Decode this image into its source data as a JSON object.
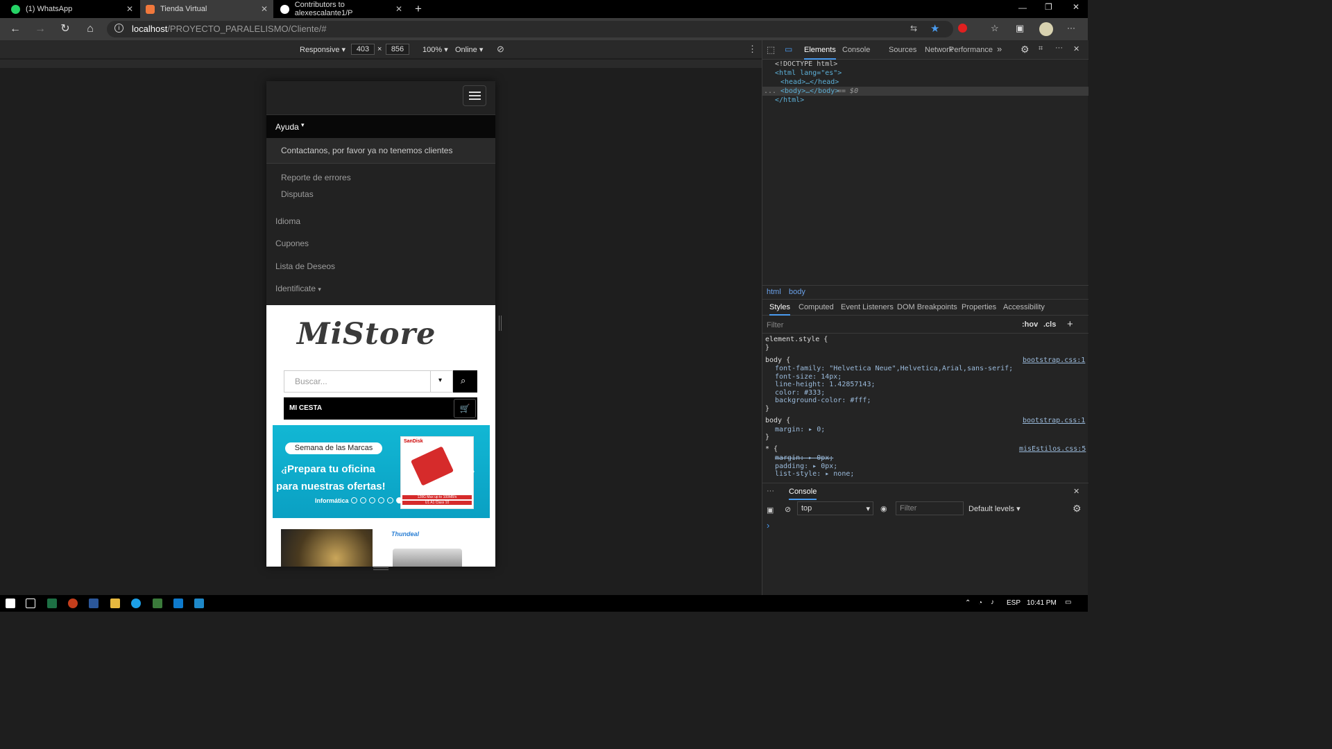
{
  "browser": {
    "tabs": [
      {
        "label": "(1) WhatsApp",
        "icon": "whatsapp-icon"
      },
      {
        "label": "Tienda Virtual",
        "icon": "xampp-icon"
      },
      {
        "label": "Contributors to alexescalante1/P",
        "icon": "github-icon"
      }
    ],
    "new_tab": "+",
    "url_host": "localhost",
    "url_path": "/PROYECTO_PARALELISMO/Cliente/#",
    "info": "i"
  },
  "device": {
    "mode": "Responsive",
    "width": "403",
    "height": "856",
    "times": "×",
    "zoom": "100%",
    "network": "Online"
  },
  "page": {
    "menu": {
      "ayuda": "Ayuda",
      "contact": "Contactanos, por favor ya no tenemos clientes",
      "reporte": "Reporte de errores",
      "disputas": "Disputas",
      "idioma": "Idioma",
      "cupones": "Cupones",
      "deseos": "Lista de Deseos",
      "identificate": "Identificate"
    },
    "logo": "MiStore",
    "search_placeholder": "Buscar...",
    "cesta": "MI CESTA",
    "banner": {
      "pill": "Semana de las Marcas",
      "line1": "¡Prepara tu oficina",
      "line2": "para nuestras ofertas!",
      "category": "Informática",
      "brand": "SanDisk",
      "spec1": "128G Max up to 100MB/s",
      "spec2": "U1 A1 Class 10",
      "original": "SanDisk Original",
      "slides": 6,
      "active_slide": 6
    },
    "thumb2_brand": "Thundeal"
  },
  "devtools": {
    "tabs": [
      "Elements",
      "Console",
      "Sources",
      "Network",
      "Performance"
    ],
    "active_tab": "Elements",
    "more": "»",
    "tree": {
      "l1": "<!DOCTYPE html>",
      "l2": "<html lang=\"es\">",
      "l3": "<head>…</head>",
      "l4": "<body>…</body>",
      "l4b": "== $0",
      "l5": "</html>",
      "dots": "..."
    },
    "crumbs": [
      "html",
      "body"
    ],
    "style_tabs": [
      "Styles",
      "Computed",
      "Event Listeners",
      "DOM Breakpoints",
      "Properties",
      "Accessibility"
    ],
    "filter": "Filter",
    "hov": ":hov",
    "cls": ".cls",
    "plus": "+",
    "rules": {
      "element_style": "element.style {",
      "close": "}",
      "body": "body {",
      "src1": "bootstrap.css:1",
      "p1": "font-family: \"Helvetica Neue\",Helvetica,Arial,sans-serif;",
      "p2": "font-size: 14px;",
      "p3": "line-height: 1.42857143;",
      "p4": "color: #333;",
      "p5": "background-color: #fff;",
      "p6": "margin: ▸ 0;",
      "star": "* {",
      "src3": "misEstilos.css:5",
      "p7": "margin: ▸ 0px;",
      "p8": "padding: ▸ 0px;",
      "p9": "list-style: ▸ none;"
    },
    "console": {
      "title": "Console",
      "context": "top",
      "filter": "Filter",
      "levels": "Default levels",
      "prompt": "›"
    }
  },
  "taskbar": {
    "lang": "ESP",
    "time": "10:41 PM"
  },
  "colors": {
    "accent": "#0078d4",
    "navbar": "#222222",
    "banner": "#12b7d4"
  }
}
